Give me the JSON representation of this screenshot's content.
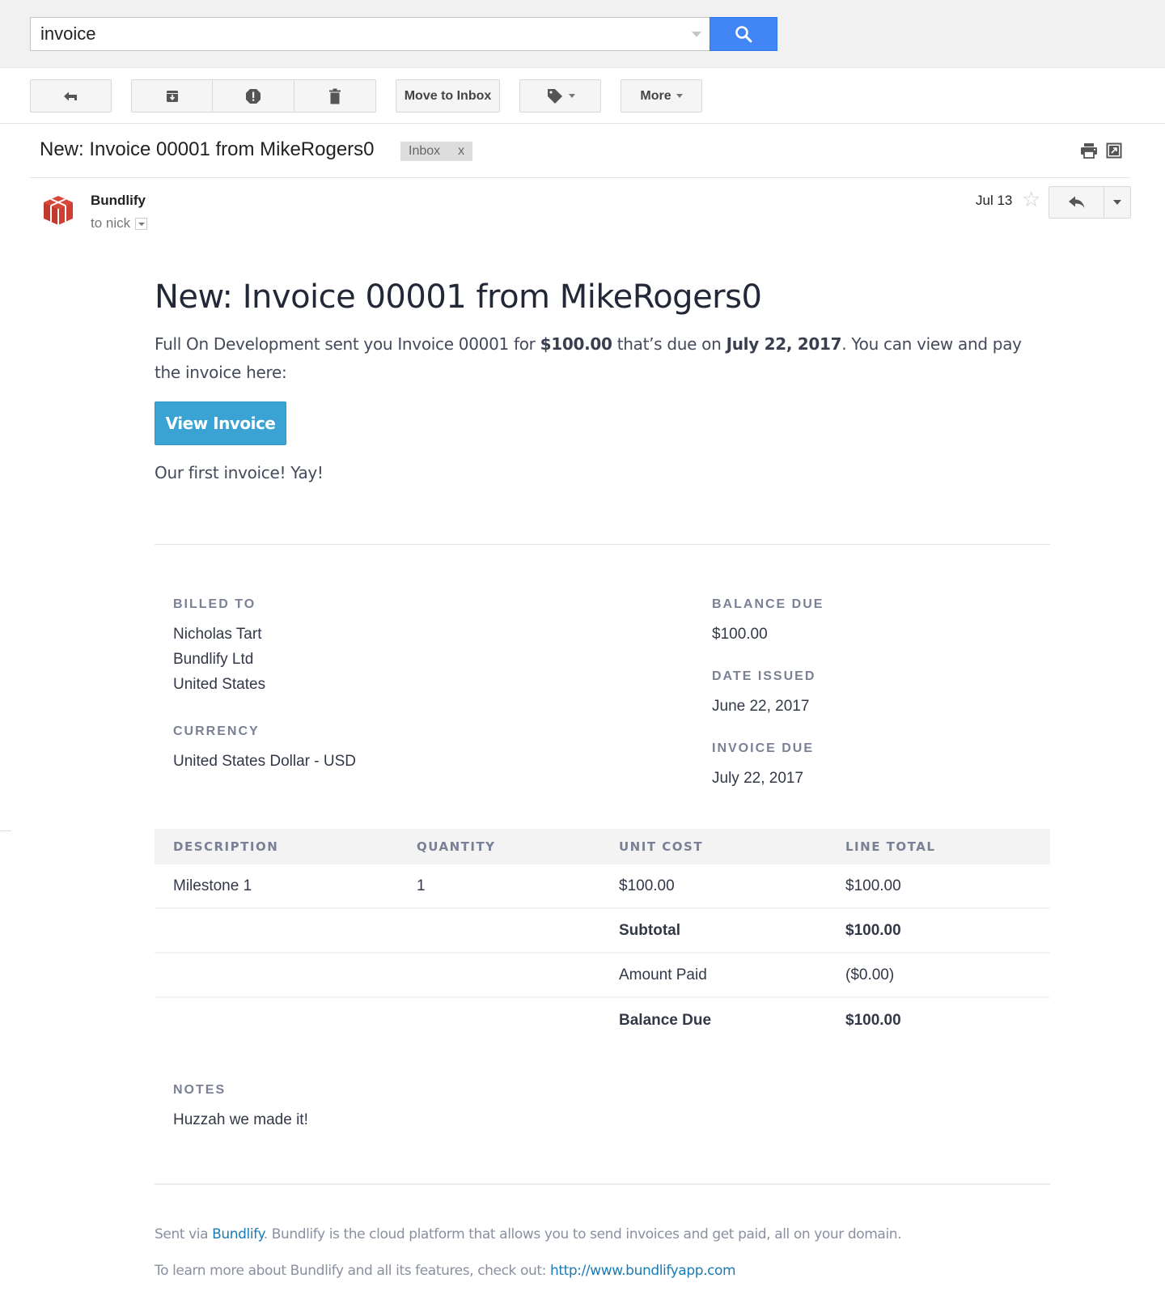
{
  "search": {
    "value": "invoice",
    "icon": "search-icon"
  },
  "toolbar": {
    "back_icon": "back-arrow-icon",
    "archive_icon": "archive-icon",
    "spam_icon": "report-spam-icon",
    "delete_icon": "trash-icon",
    "move_to_inbox_label": "Move to Inbox",
    "labels_icon": "label-tag-icon",
    "more_label": "More"
  },
  "thread": {
    "subject": "New: Invoice 00001 from MikeRogers0",
    "label": "Inbox",
    "label_remove": "x"
  },
  "message_header": {
    "sender": "Bundlify",
    "to": "to nick",
    "date": "Jul 13"
  },
  "email": {
    "heading": "New: Invoice 00001 from MikeRogers0",
    "intro_part1": "Full On Development sent you Invoice 00001 for ",
    "intro_amount": "$100.00",
    "intro_part2": " that’s due on ",
    "intro_due": "July 22, 2017",
    "intro_part3": ". You can view and pay the invoice here:",
    "view_button": "View Invoice",
    "message": "Our first invoice! Yay!",
    "accent_color": "#3aa3d3"
  },
  "invoice": {
    "billed_to_label": "BILLED TO",
    "billed_to": [
      "Nicholas Tart",
      "Bundlify Ltd",
      "United States"
    ],
    "currency_label": "CURRENCY",
    "currency": "United States Dollar - USD",
    "balance_due_label": "BALANCE DUE",
    "balance_due": "$100.00",
    "date_issued_label": "DATE ISSUED",
    "date_issued": "June 22, 2017",
    "invoice_due_label": "INVOICE DUE",
    "invoice_due": "July 22, 2017",
    "columns": [
      "DESCRIPTION",
      "QUANTITY",
      "UNIT COST",
      "LINE TOTAL"
    ],
    "items": [
      {
        "description": "Milestone 1",
        "quantity": "1",
        "unit_cost": "$100.00",
        "line_total": "$100.00"
      }
    ],
    "totals": [
      {
        "label": "Subtotal",
        "value": "$100.00"
      },
      {
        "label": "Amount Paid",
        "value": "($0.00)"
      },
      {
        "label": "Balance Due",
        "value": "$100.00"
      }
    ],
    "notes_label": "NOTES",
    "notes": "Huzzah we made it!"
  },
  "footer": {
    "line1_prefix": "Sent via ",
    "line1_link": "Bundlify",
    "line1_suffix": ". Bundlify is the cloud platform that allows you to send invoices and get paid, all on your domain.",
    "line2_prefix": "To learn more about Bundlify and all its features, check out: ",
    "line2_link": "http://www.bundlifyapp.com"
  }
}
